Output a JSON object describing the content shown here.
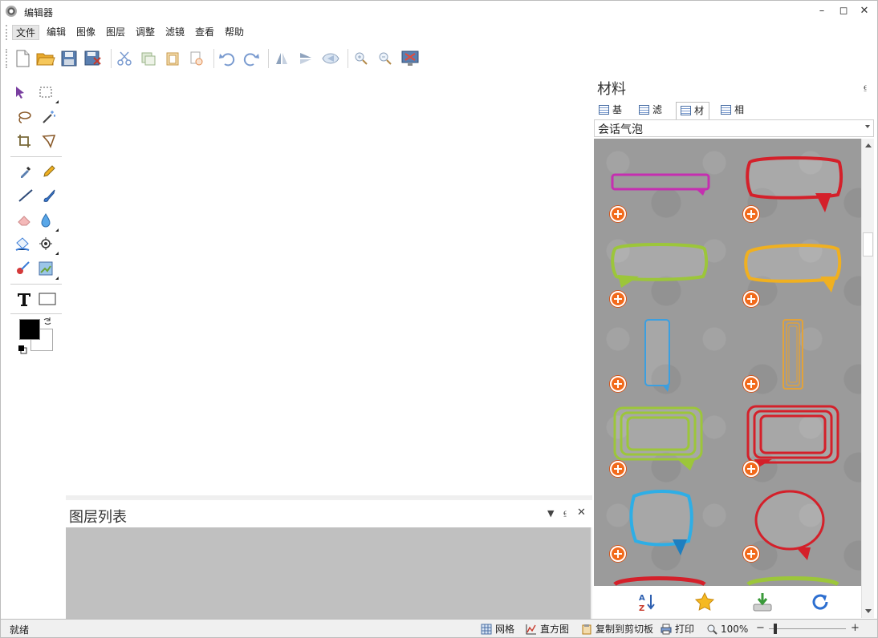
{
  "window": {
    "title": "编辑器"
  },
  "menu": {
    "items": [
      "文件",
      "编辑",
      "图像",
      "图层",
      "调整",
      "滤镜",
      "查看",
      "帮助"
    ]
  },
  "toolbar": {
    "buttons": [
      "new-file-icon",
      "open-folder-icon",
      "save-icon",
      "save-as-icon",
      "cut-icon",
      "copy-icon",
      "paste-icon",
      "clear-icon",
      "undo-icon",
      "redo-icon",
      "flip-vertical-icon",
      "flip-horizontal-icon",
      "rotate-icon",
      "zoom-in-icon",
      "zoom-out-icon",
      "fit-screen-icon"
    ]
  },
  "tools": [
    "pointer-icon",
    "rect-select-icon",
    "lasso-icon",
    "magic-wand-icon",
    "crop-icon",
    "perspective-icon",
    "eyedropper-icon",
    "pencil-icon",
    "line-icon",
    "brush-icon",
    "eraser-icon",
    "blur-drop-icon",
    "fill-bucket-icon",
    "clone-stamp-icon",
    "red-eye-icon",
    "image-adjust-icon",
    "text-tool-icon",
    "rectangle-icon"
  ],
  "colors": {
    "foreground": "#000000",
    "background": "#ffffff"
  },
  "layers_panel": {
    "title": "图层列表"
  },
  "material_panel": {
    "title": "材料",
    "tabs": [
      "基本",
      "滤镜",
      "材料",
      "相框"
    ],
    "active_tab": "材料",
    "category": "会话气泡",
    "bubble_colors": [
      "#c52fb0",
      "#d4202a",
      "#9cc63a",
      "#f0b020",
      "#3b9fe0",
      "#e2a23a",
      "#9cc63a",
      "#d4202a",
      "#2eaee6",
      "#d4202a",
      "#d4202a",
      "#9cc63a"
    ],
    "bottom_buttons": [
      "sort-az-icon",
      "star-icon",
      "download-icon",
      "refresh-icon"
    ]
  },
  "statusbar": {
    "status": "就绪",
    "grid": "网格",
    "histogram": "直方图",
    "copy_clipboard": "复制到剪切板",
    "print": "打印",
    "zoom": "100%",
    "zoom_minus": "−",
    "zoom_plus": "+"
  },
  "accent": "#f26a1b"
}
